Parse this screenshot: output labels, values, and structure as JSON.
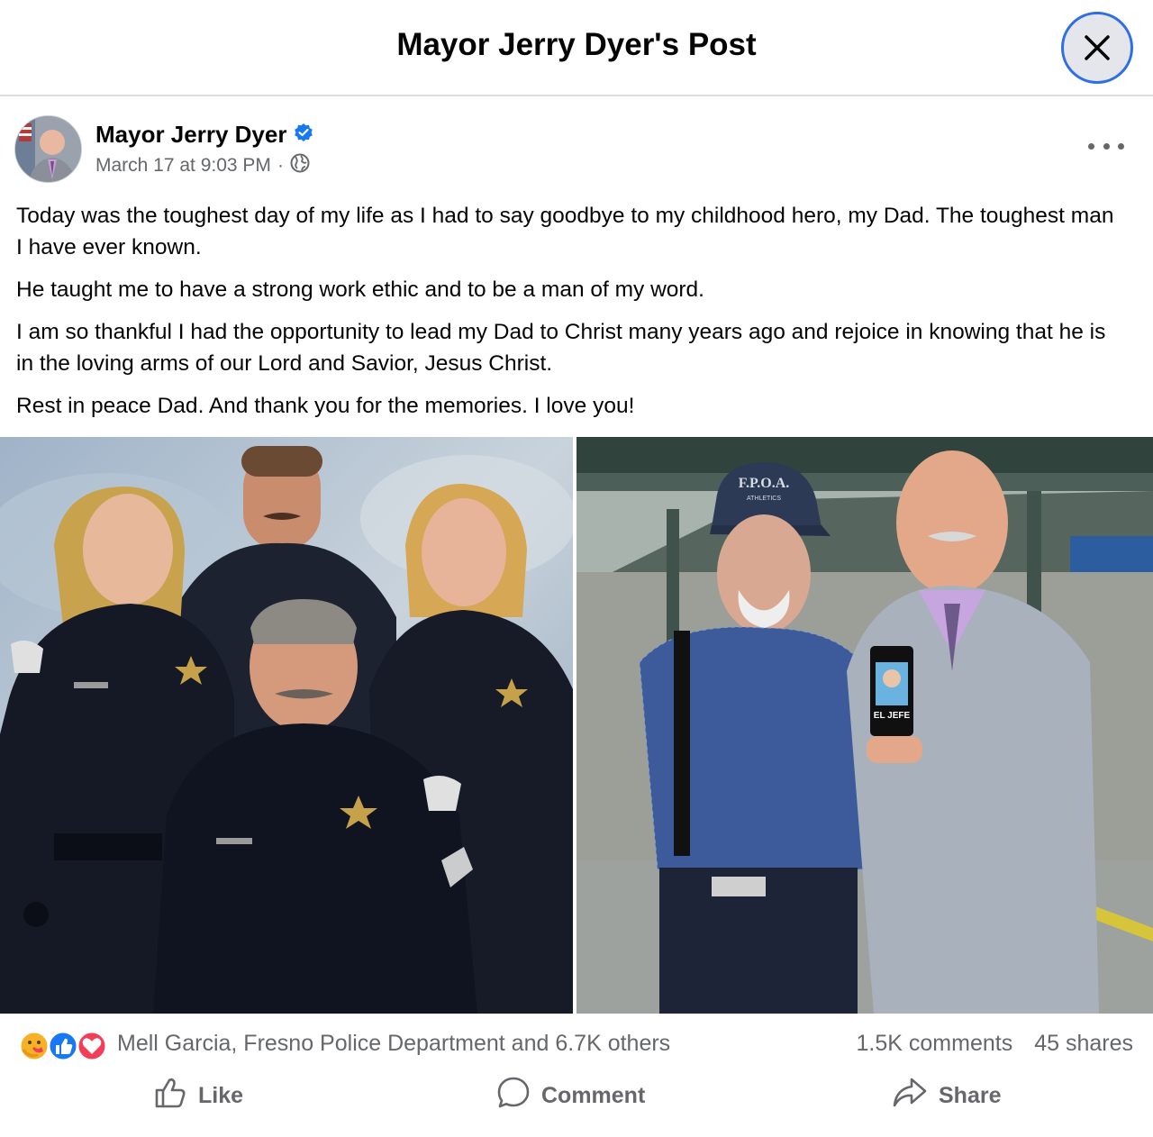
{
  "header": {
    "title": "Mayor Jerry Dyer's Post"
  },
  "post": {
    "author": "Mayor Jerry Dyer",
    "timestamp": "March 17 at 9:03 PM",
    "separator": "·",
    "paragraphs": [
      "Today was the toughest day of my life as I had to say goodbye to my childhood hero, my Dad.  The toughest man I have ever known.",
      "He taught me to have a strong work ethic and to be a man of my word.",
      "I am so thankful I had the opportunity to lead my Dad to Christ many years ago and rejoice in knowing that he is in the loving arms of our Lord and Savior, Jesus Christ.",
      "Rest in peace Dad.  And thank you for the memories.  I love you!"
    ]
  },
  "photo_text": {
    "cap_text": "F.P.O.A.",
    "cap_subtext": "ATHLETICS",
    "can_label": "EL JEFE"
  },
  "stats": {
    "reaction_names": "Mell Garcia, Fresno Police Department and 6.7K others",
    "comments": "1.5K comments",
    "shares": "45 shares"
  },
  "actions": {
    "like": "Like",
    "comment": "Comment",
    "share": "Share"
  },
  "colors": {
    "verified": "#1877f2",
    "like": "#1877f2",
    "love": "#f33e58",
    "care": "#f7b125",
    "focus_ring": "#2e6ee6"
  },
  "icons": [
    "close-icon",
    "verified-badge-icon",
    "globe-icon",
    "more-options-icon",
    "care-reaction-icon",
    "like-reaction-icon",
    "love-reaction-icon",
    "like-icon",
    "comment-icon",
    "share-icon"
  ]
}
